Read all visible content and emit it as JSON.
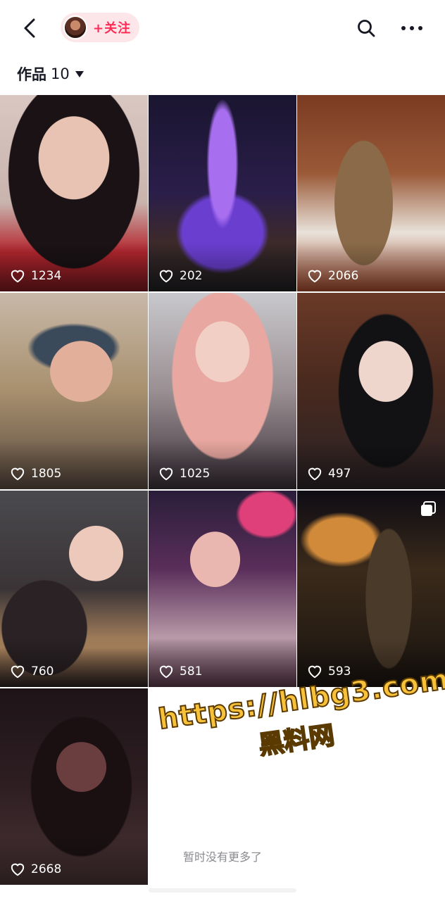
{
  "header": {
    "back_icon": "chevron-left-icon",
    "follow_label": "+关注",
    "search_icon": "search-icon",
    "more_icon": "more-horizontal-icon"
  },
  "works": {
    "label": "作品",
    "count": "10",
    "caret_icon": "caret-down-icon"
  },
  "tiles": [
    {
      "likes": "1234",
      "multi": false
    },
    {
      "likes": "202",
      "multi": false
    },
    {
      "likes": "2066",
      "multi": false
    },
    {
      "likes": "1805",
      "multi": false
    },
    {
      "likes": "1025",
      "multi": false
    },
    {
      "likes": "497",
      "multi": false
    },
    {
      "likes": "760",
      "multi": false
    },
    {
      "likes": "581",
      "multi": false
    },
    {
      "likes": "593",
      "multi": true
    },
    {
      "likes": "2668",
      "multi": false
    }
  ],
  "watermark": {
    "line1": "https://hlbg3.com",
    "line2": "黑料网"
  },
  "footer": {
    "end_note": "暂时没有更多了"
  },
  "colors": {
    "accent": "#fe2c55",
    "follow_bg": "#fde6ea",
    "watermark_fill": "#f7c23a",
    "muted_text": "#8a8b91"
  }
}
